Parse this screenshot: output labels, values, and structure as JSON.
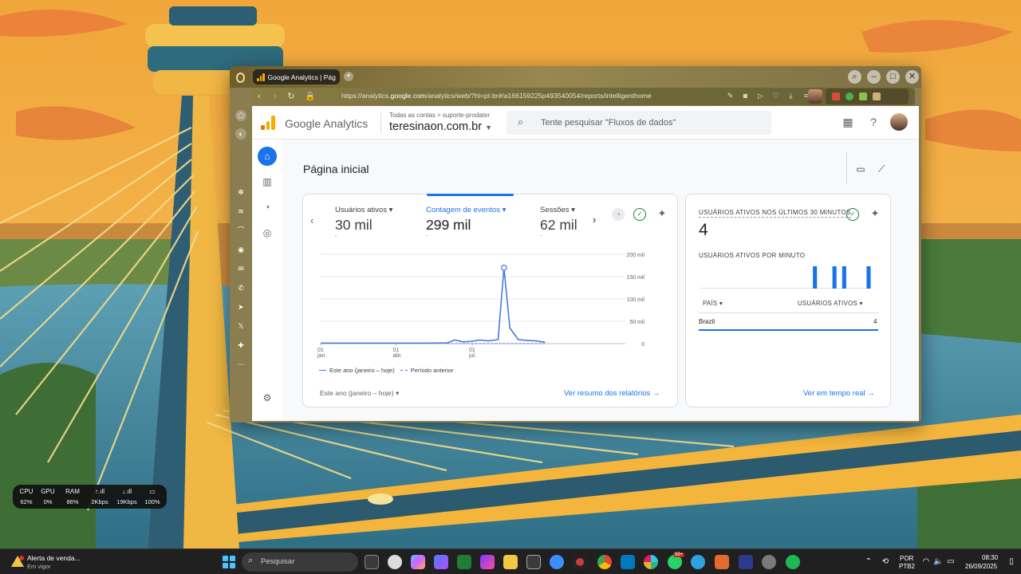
{
  "browser": {
    "tab_title": "Google Analytics | Págin",
    "new_tab": "+",
    "url_prefix": "https://analytics.",
    "url_domain": "google.com",
    "url_rest": "/analytics/web/?hl=pt-br#/a166159225p493540054/reports/intelligenthome",
    "window_controls": {
      "search": "⌕",
      "minimize": "–",
      "maximize": "□",
      "close": "✕"
    }
  },
  "ga": {
    "product_name": "Google Analytics",
    "breadcrumb": "Todas as contas > suporte-prodater",
    "property": "teresinaon.com.br",
    "search_placeholder": "Tente pesquisar \"Fluxos de dados\"",
    "page_title": "Página inicial",
    "metrics": [
      {
        "label": "Usuários ativos",
        "value": "30 mil",
        "sub": "-"
      },
      {
        "label": "Contagem de eventos",
        "value": "299 mil",
        "sub": "-"
      },
      {
        "label": "Sessões",
        "value": "62 mil",
        "sub": "-"
      }
    ],
    "legend_current": "Este ano (janeiro – hoje)",
    "legend_previous": "Período anterior",
    "date_selector": "Este ano (janeiro – hoje)",
    "report_link": "Ver resumo dos relatórios",
    "realtime": {
      "title": "USUÁRIOS ATIVOS NOS ÚLTIMOS 30 MINUTOS",
      "count": "4",
      "per_minute_label": "USUÁRIOS ATIVOS POR MINUTO",
      "col_country": "PAÍS",
      "col_users": "USUÁRIOS ATIVOS",
      "row_country": "Brazil",
      "row_value": "4",
      "per_minute_bars": [
        0,
        0,
        0,
        0,
        0,
        0,
        0,
        0,
        0,
        0,
        0,
        0,
        0,
        0,
        0,
        0,
        0,
        0,
        0,
        0,
        0,
        0,
        0,
        1,
        0,
        0,
        0,
        1,
        0,
        1,
        0,
        0,
        0,
        0,
        1
      ],
      "link": "Ver em tempo real"
    }
  },
  "chart_data": {
    "type": "line",
    "x_ticks": [
      {
        "day": "01",
        "month": "jan."
      },
      {
        "day": "01",
        "month": "abr."
      },
      {
        "day": "01",
        "month": "jul."
      }
    ],
    "y_ticks": [
      "200 mil",
      "150 mil",
      "100 mil",
      "50 mil",
      "0"
    ],
    "ylim": [
      0,
      200000
    ],
    "series": [
      {
        "name": "Este ano (janeiro – hoje)",
        "style": "solid",
        "color": "#4a7ad8",
        "x": [
          "2025-01-01",
          "2025-02-01",
          "2025-03-01",
          "2025-04-01",
          "2025-05-01",
          "2025-06-01",
          "2025-06-10",
          "2025-06-20",
          "2025-06-30",
          "2025-07-10",
          "2025-07-20",
          "2025-08-01",
          "2025-08-08",
          "2025-08-15",
          "2025-08-25",
          "2025-09-05",
          "2025-09-15",
          "2025-09-26"
        ],
        "y": [
          1000,
          1000,
          1000,
          1000,
          1000,
          1500,
          8000,
          4000,
          5000,
          8000,
          6000,
          9000,
          170000,
          35000,
          9000,
          7000,
          6000,
          3000
        ]
      },
      {
        "name": "Período anterior",
        "style": "dashed",
        "color": "#4a7ad8",
        "x": [
          "2025-06-01",
          "2025-07-01",
          "2025-08-01",
          "2025-09-01",
          "2025-09-26"
        ],
        "y": [
          0,
          0,
          0,
          0,
          0
        ]
      }
    ]
  },
  "widget": {
    "labels": [
      "CPU",
      "GPU",
      "RAM",
      "↑.ıll",
      "↓.ıll",
      "▭"
    ],
    "values": [
      "62%",
      "0%",
      "86%",
      "2Kbps",
      "19Kbps",
      "100%"
    ]
  },
  "taskbar": {
    "alert_title": "Alerta de venda...",
    "alert_sub": "Em vigor",
    "search": "Pesquisar",
    "badge": "99+",
    "lang1": "POR",
    "lang2": "PTB2",
    "time": "08:30",
    "date": "26/09/2025"
  }
}
